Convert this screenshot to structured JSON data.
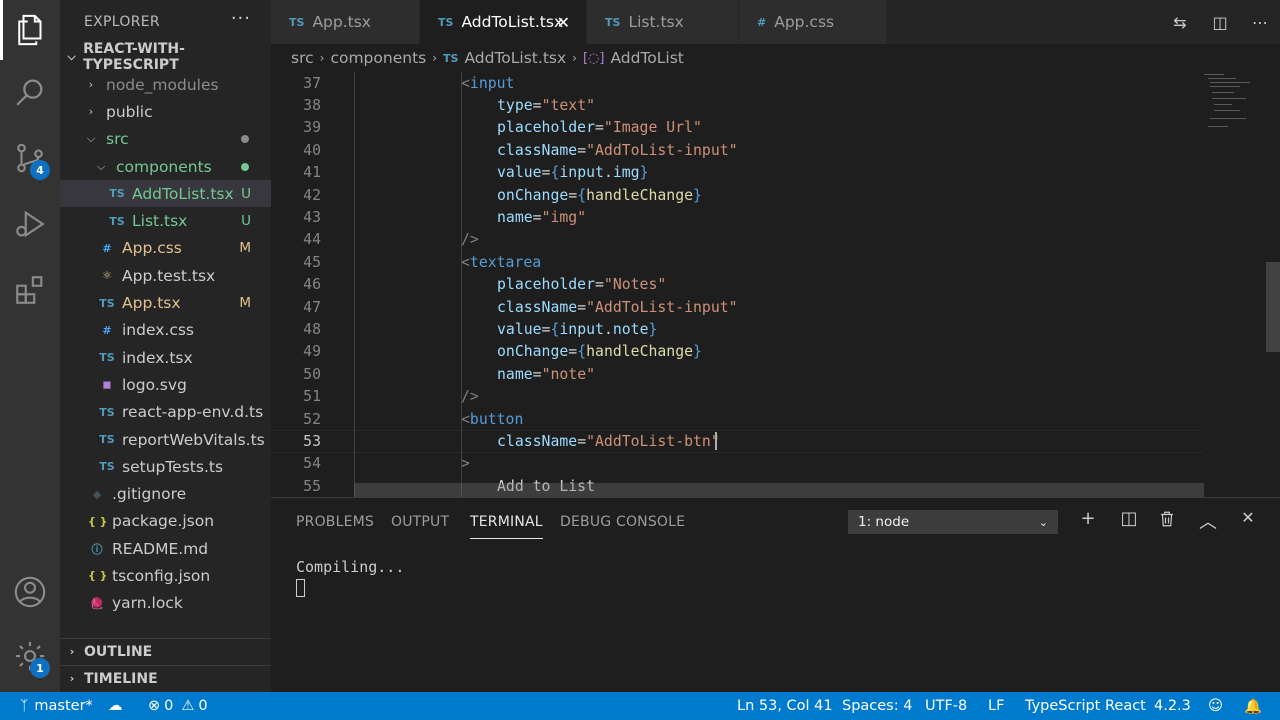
{
  "activity_bar": {
    "items": [
      {
        "name": "explorer-icon"
      },
      {
        "name": "search-icon"
      },
      {
        "name": "source-control-icon",
        "badge": "4"
      },
      {
        "name": "run-debug-icon"
      },
      {
        "name": "extensions-icon"
      }
    ],
    "bottom": [
      {
        "name": "account-icon"
      },
      {
        "name": "manage-gear-icon",
        "badge": "1"
      }
    ]
  },
  "sidebar": {
    "title": "EXPLORER",
    "more": "···",
    "project": "REACT-WITH-TYPESCRIPT",
    "tree": [
      {
        "label": "node_modules",
        "type": "folder",
        "indent": 1,
        "color": "#8c8c8c"
      },
      {
        "label": "public",
        "type": "folder",
        "indent": 1,
        "color": "#cccccc"
      },
      {
        "label": "src",
        "type": "folder-open",
        "indent": 1,
        "color": "#73c991",
        "dot": "#8c8c8c"
      },
      {
        "label": "components",
        "type": "folder-open",
        "indent": 2,
        "color": "#73c991",
        "dot": "#73c991"
      },
      {
        "label": "AddToList.tsx",
        "type": "ts",
        "indent": 3,
        "color": "#73c991",
        "status": "U",
        "selected": true
      },
      {
        "label": "List.tsx",
        "type": "ts",
        "indent": 3,
        "color": "#73c991",
        "status": "U"
      },
      {
        "label": "App.css",
        "type": "css",
        "indent": 2,
        "color": "#e2c08d",
        "status": "M"
      },
      {
        "label": "App.test.tsx",
        "type": "react",
        "indent": 2,
        "color": "#cccccc"
      },
      {
        "label": "App.tsx",
        "type": "ts",
        "indent": 2,
        "color": "#e2c08d",
        "status": "M"
      },
      {
        "label": "index.css",
        "type": "css",
        "indent": 2,
        "color": "#cccccc"
      },
      {
        "label": "index.tsx",
        "type": "ts",
        "indent": 2,
        "color": "#cccccc"
      },
      {
        "label": "logo.svg",
        "type": "svg",
        "indent": 2,
        "color": "#cccccc"
      },
      {
        "label": "react-app-env.d.ts",
        "type": "ts",
        "indent": 2,
        "color": "#cccccc"
      },
      {
        "label": "reportWebVitals.ts",
        "type": "ts",
        "indent": 2,
        "color": "#cccccc"
      },
      {
        "label": "setupTests.ts",
        "type": "ts",
        "indent": 2,
        "color": "#cccccc"
      },
      {
        "label": ".gitignore",
        "type": "git",
        "indent": 1,
        "color": "#cccccc"
      },
      {
        "label": "package.json",
        "type": "json",
        "indent": 1,
        "color": "#cccccc"
      },
      {
        "label": "README.md",
        "type": "info",
        "indent": 1,
        "color": "#cccccc"
      },
      {
        "label": "tsconfig.json",
        "type": "json",
        "indent": 1,
        "color": "#cccccc"
      },
      {
        "label": "yarn.lock",
        "type": "yarn",
        "indent": 1,
        "color": "#cccccc"
      }
    ],
    "outline": "OUTLINE",
    "timeline": "TIMELINE"
  },
  "tabs": [
    {
      "label": "App.tsx",
      "icon": "TS",
      "active": false
    },
    {
      "label": "AddToList.tsx",
      "icon": "TS",
      "active": true,
      "close": "✕"
    },
    {
      "label": "List.tsx",
      "icon": "TS",
      "active": false
    },
    {
      "label": "App.css",
      "icon": "#",
      "active": false
    }
  ],
  "breadcrumb": {
    "parts": [
      "src",
      "components",
      "AddToList.tsx",
      "AddToList"
    ],
    "ts_icon": "TS"
  },
  "editor": {
    "lines": [
      {
        "n": "37",
        "indent": 0,
        "tokens": [
          [
            "t-punc",
            "<"
          ],
          [
            "t-tag",
            "input"
          ]
        ]
      },
      {
        "n": "38",
        "indent": 1,
        "tokens": [
          [
            "t-attr",
            "type"
          ],
          [
            "t-text",
            "="
          ],
          [
            "t-str",
            "\"text\""
          ]
        ]
      },
      {
        "n": "39",
        "indent": 1,
        "tokens": [
          [
            "t-attr",
            "placeholder"
          ],
          [
            "t-text",
            "="
          ],
          [
            "t-str",
            "\"Image Url\""
          ]
        ]
      },
      {
        "n": "40",
        "indent": 1,
        "tokens": [
          [
            "t-attr",
            "className"
          ],
          [
            "t-text",
            "="
          ],
          [
            "t-str",
            "\"AddToList-input\""
          ]
        ]
      },
      {
        "n": "41",
        "indent": 1,
        "tokens": [
          [
            "t-attr",
            "value"
          ],
          [
            "t-text",
            "="
          ],
          [
            "t-brace",
            "{"
          ],
          [
            "t-var",
            "input"
          ],
          [
            "t-text",
            "."
          ],
          [
            "t-var",
            "img"
          ],
          [
            "t-brace",
            "}"
          ]
        ]
      },
      {
        "n": "42",
        "indent": 1,
        "tokens": [
          [
            "t-attr",
            "onChange"
          ],
          [
            "t-text",
            "="
          ],
          [
            "t-brace",
            "{"
          ],
          [
            "t-fn",
            "handleChange"
          ],
          [
            "t-brace",
            "}"
          ]
        ]
      },
      {
        "n": "43",
        "indent": 1,
        "tokens": [
          [
            "t-attr",
            "name"
          ],
          [
            "t-text",
            "="
          ],
          [
            "t-str",
            "\"img\""
          ]
        ]
      },
      {
        "n": "44",
        "indent": 0,
        "tokens": [
          [
            "t-punc",
            "/>"
          ]
        ]
      },
      {
        "n": "45",
        "indent": 0,
        "tokens": [
          [
            "t-punc",
            "<"
          ],
          [
            "t-tag",
            "textarea"
          ]
        ]
      },
      {
        "n": "46",
        "indent": 1,
        "tokens": [
          [
            "t-attr",
            "placeholder"
          ],
          [
            "t-text",
            "="
          ],
          [
            "t-str",
            "\"Notes\""
          ]
        ]
      },
      {
        "n": "47",
        "indent": 1,
        "tokens": [
          [
            "t-attr",
            "className"
          ],
          [
            "t-text",
            "="
          ],
          [
            "t-str",
            "\"AddToList-input\""
          ]
        ]
      },
      {
        "n": "48",
        "indent": 1,
        "tokens": [
          [
            "t-attr",
            "value"
          ],
          [
            "t-text",
            "="
          ],
          [
            "t-brace",
            "{"
          ],
          [
            "t-var",
            "input"
          ],
          [
            "t-text",
            "."
          ],
          [
            "t-var",
            "note"
          ],
          [
            "t-brace",
            "}"
          ]
        ]
      },
      {
        "n": "49",
        "indent": 1,
        "tokens": [
          [
            "t-attr",
            "onChange"
          ],
          [
            "t-text",
            "="
          ],
          [
            "t-brace",
            "{"
          ],
          [
            "t-fn",
            "handleChange"
          ],
          [
            "t-brace",
            "}"
          ]
        ]
      },
      {
        "n": "50",
        "indent": 1,
        "tokens": [
          [
            "t-attr",
            "name"
          ],
          [
            "t-text",
            "="
          ],
          [
            "t-str",
            "\"note\""
          ]
        ]
      },
      {
        "n": "51",
        "indent": 0,
        "tokens": [
          [
            "t-punc",
            "/>"
          ]
        ]
      },
      {
        "n": "52",
        "indent": 0,
        "tokens": [
          [
            "t-punc",
            "<"
          ],
          [
            "t-tag",
            "button"
          ]
        ]
      },
      {
        "n": "53",
        "indent": 1,
        "current": true,
        "tokens": [
          [
            "t-attr",
            "className"
          ],
          [
            "t-text",
            "="
          ],
          [
            "t-str",
            "\"AddToList-btn\""
          ]
        ]
      },
      {
        "n": "54",
        "indent": 0,
        "tokens": [
          [
            "t-punc",
            ">"
          ]
        ]
      },
      {
        "n": "55",
        "indent": 1,
        "tokens": [
          [
            "t-text",
            "Add to List"
          ]
        ]
      }
    ]
  },
  "panel": {
    "tabs": [
      "PROBLEMS",
      "OUTPUT",
      "TERMINAL",
      "DEBUG CONSOLE"
    ],
    "active_tab": "TERMINAL",
    "terminal_select": "1: node",
    "terminal_output": "Compiling...",
    "actions": [
      {
        "name": "new-terminal-icon",
        "glyph": "+"
      },
      {
        "name": "split-terminal-icon",
        "glyph": "◫"
      },
      {
        "name": "trash-icon",
        "glyph": "🗑"
      },
      {
        "name": "maximize-panel-icon",
        "glyph": "︿"
      },
      {
        "name": "close-panel-icon",
        "glyph": "✕"
      }
    ]
  },
  "status_bar": {
    "branch": "master*",
    "errors": "0",
    "warnings": "0",
    "position": "Ln 53, Col 41",
    "spaces": "Spaces: 4",
    "encoding": "UTF-8",
    "eol": "LF",
    "language": "TypeScript React",
    "version": "4.2.3"
  },
  "colors": {
    "accent": "#007acc",
    "git_untracked": "#73c991",
    "git_modified": "#e2c08d",
    "ts_blue": "#519aba"
  }
}
